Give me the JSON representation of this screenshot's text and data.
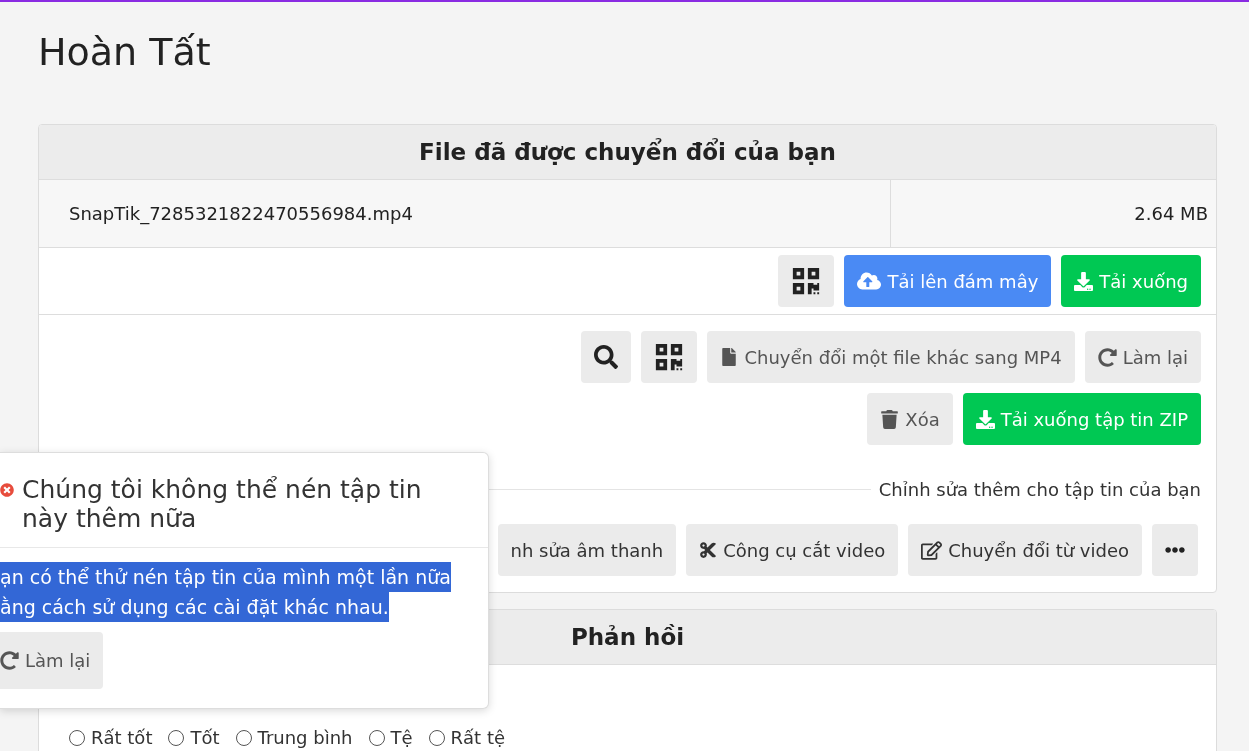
{
  "page_title": "Hoàn Tất",
  "file_card": {
    "title": "File đã được chuyển đổi của bạn",
    "file": {
      "name": "SnapTik_7285321822470556984.mp4",
      "size": "2.64 MB"
    },
    "file_actions": [
      {
        "kind": "qr"
      },
      {
        "kind": "upload",
        "label": "Tải lên đám mây"
      },
      {
        "kind": "download",
        "label": "Tải xuống"
      }
    ],
    "tools": [
      {
        "kind": "search"
      },
      {
        "kind": "qr"
      },
      {
        "kind": "file",
        "label": "Chuyển đổi một file khác sang MP4"
      },
      {
        "kind": "redo",
        "label": "Làm lại"
      }
    ],
    "tools_row2": [
      {
        "kind": "trash",
        "label": "Xóa"
      },
      {
        "kind": "download",
        "label": "Tải xuống tập tin ZIP"
      }
    ],
    "edit_heading": "Chỉnh sửa thêm cho tập tin của bạn",
    "edit_tools": [
      {
        "kind": "plain",
        "label": "nh sửa âm thanh"
      },
      {
        "kind": "scissors",
        "label": "Công cụ cắt video"
      },
      {
        "kind": "edit",
        "label": "Chuyển đổi từ video"
      },
      {
        "kind": "more"
      }
    ]
  },
  "feedback": {
    "title": "Phản hồi",
    "ratings": [
      {
        "label": "Rất tốt",
        "selected": false
      },
      {
        "label": "Tốt",
        "selected": false
      },
      {
        "label": "Trung bình",
        "selected": false
      },
      {
        "label": "Tệ",
        "selected": false
      },
      {
        "label": "Rất tệ",
        "selected": false
      }
    ]
  },
  "error_popup": {
    "title": "Chúng tôi không thể nén tập tin này thêm nữa",
    "message_lines": [
      "ạn có thể thử nén tập tin của mình một lần nữa",
      "ằng cách sử dụng các cài đặt khác nhau."
    ],
    "highlighted": true,
    "button": {
      "kind": "redo",
      "label": "Làm lại"
    }
  }
}
